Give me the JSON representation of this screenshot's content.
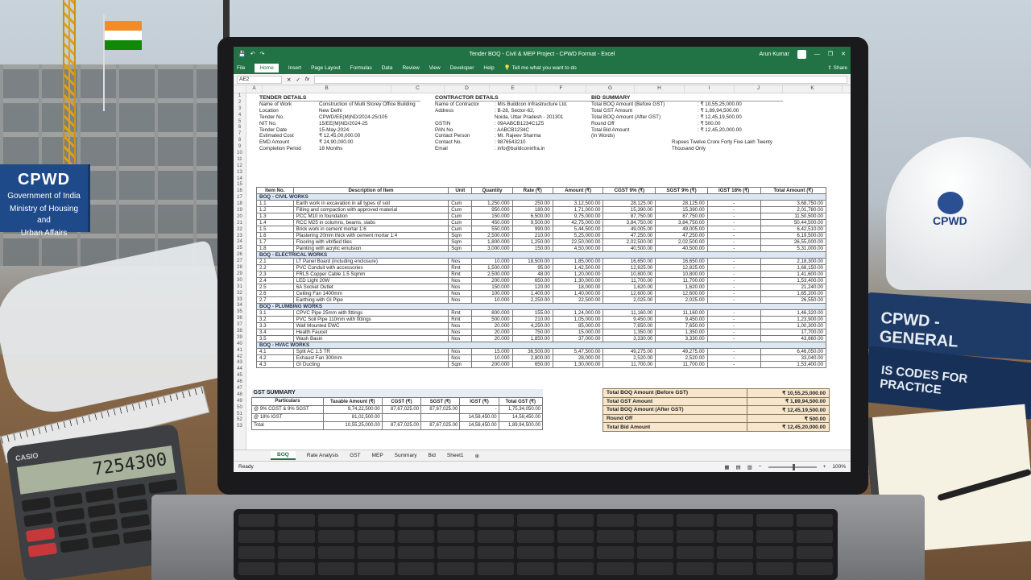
{
  "background": {
    "board": {
      "title": "CPWD",
      "line1": "Government of India",
      "line2": "Ministry of Housing and",
      "line3": "Urban Affairs"
    },
    "helmet_logo": "CPWD",
    "book1": "CPWD - GENERAL",
    "book2": "IS CODES FOR PRACTICE",
    "calculator": {
      "brand": "CASIO",
      "display": "7254300"
    }
  },
  "window": {
    "title": "Tender BOQ - Civil & MEP Project - CPWD Format - Excel",
    "user": "Arun Kumar",
    "tabs": [
      "File",
      "Home",
      "Insert",
      "Page Layout",
      "Formulas",
      "Data",
      "Review",
      "View",
      "Developer",
      "Help"
    ],
    "tell_me": "Tell me what you want to do",
    "share": "Share",
    "name_box": "AE2",
    "columns": [
      "A",
      "B",
      "C",
      "D",
      "E",
      "F",
      "G",
      "H",
      "I",
      "J",
      "K"
    ]
  },
  "tender": {
    "header": "TENDER DETAILS",
    "rows": [
      [
        "Name of Work",
        "Construction of Multi Storey Office Building"
      ],
      [
        "Location",
        "New Delhi"
      ],
      [
        "Tender No.",
        "CPWD/EE(M)ND/2024-25/105"
      ],
      [
        "NIT No.",
        "15/EE(M)ND/2024-25"
      ],
      [
        "Tender Date",
        "15-May-2024"
      ],
      [
        "Estimated Cost",
        "₹ 12,45,00,000.00"
      ],
      [
        "EMD Amount",
        "₹ 24,90,000.00"
      ],
      [
        "Completion Period",
        "18 Months"
      ]
    ]
  },
  "contractor": {
    "header": "CONTRACTOR DETAILS",
    "rows": [
      [
        "Name of Contractor",
        ": M/s Buildcon Infrastructure Ltd."
      ],
      [
        "Address",
        ": B-28, Sector-62,"
      ],
      [
        "",
        "Noida, Uttar Pradesh - 201301"
      ],
      [
        "GSTIN",
        ": 09AABCB1234C1Z5"
      ],
      [
        "PAN No.",
        ": AABCB1234C"
      ],
      [
        "Contact Person",
        ": Mr. Rajeev Sharma"
      ],
      [
        "Contact No.",
        ": 9876543210"
      ],
      [
        "Email",
        ": info@buildconinfra.in"
      ]
    ]
  },
  "bid": {
    "header": "BID SUMMARY",
    "rows": [
      [
        "Total BOQ Amount (Before GST)",
        ": ₹ 10,55,25,000.00"
      ],
      [
        "Total GST Amount",
        ": ₹ 1,89,94,500.00"
      ],
      [
        "Total BOQ Amount (After GST)",
        ": ₹ 12,45,19,500.00"
      ],
      [
        "Round Off",
        ": ₹ 500.00"
      ],
      [
        "Total Bid Amount",
        ": ₹ 12,45,20,000.00"
      ],
      [
        "(In Words)",
        "Rupees Twelve Crore Forty Five Lakh Twenty Thousand Only"
      ]
    ]
  },
  "boq": {
    "headers": [
      "Item No.",
      "Description of Item",
      "Unit",
      "Quantity",
      "Rate (₹)",
      "Amount (₹)",
      "CGST 9% (₹)",
      "SGST 9% (₹)",
      "IGST 18% (₹)",
      "Total Amount (₹)"
    ],
    "sections": [
      {
        "title": "BOQ - CIVIL WORKS",
        "rows": [
          [
            "1.1",
            "Earth work in excavation in all types of soil",
            "Cum",
            "1,250.000",
            "250.00",
            "3,12,500.00",
            "28,125.00",
            "28,125.00",
            "-",
            "3,68,750.00"
          ],
          [
            "1.2",
            "Filling and compaction with approved material",
            "Cum",
            "950.000",
            "180.00",
            "1,71,000.00",
            "15,390.00",
            "15,390.00",
            "-",
            "2,01,780.00"
          ],
          [
            "1.3",
            "PCC M10 in foundation",
            "Cum",
            "150.000",
            "6,500.00",
            "9,75,000.00",
            "87,750.00",
            "87,750.00",
            "-",
            "11,50,500.00"
          ],
          [
            "1.4",
            "RCC M25 in columns, beams, slabs",
            "Cum",
            "450.000",
            "9,500.00",
            "42,75,000.00",
            "3,84,750.00",
            "3,84,750.00",
            "-",
            "50,44,500.00"
          ],
          [
            "1.5",
            "Brick work in cement mortar 1:6",
            "Cum",
            "550.000",
            "990.00",
            "5,44,500.00",
            "49,005.00",
            "49,005.00",
            "-",
            "6,42,510.00"
          ],
          [
            "1.6",
            "Plastering 20mm thick with cement mortar 1:4",
            "Sqm",
            "2,500.000",
            "210.00",
            "5,25,000.00",
            "47,250.00",
            "47,250.00",
            "-",
            "6,19,500.00"
          ],
          [
            "1.7",
            "Flooring with vitrified tiles",
            "Sqm",
            "1,800.000",
            "1,250.00",
            "22,50,000.00",
            "2,02,500.00",
            "2,02,500.00",
            "-",
            "26,55,000.00"
          ],
          [
            "1.8",
            "Painting with acrylic emulsion",
            "Sqm",
            "3,000.000",
            "150.00",
            "4,50,000.00",
            "40,500.00",
            "40,500.00",
            "-",
            "5,31,000.00"
          ]
        ]
      },
      {
        "title": "BOQ - ELECTRICAL WORKS",
        "rows": [
          [
            "2.1",
            "LT Panel Board (including enclosure)",
            "Nos",
            "10.000",
            "18,500.00",
            "1,85,000.00",
            "16,650.00",
            "16,650.00",
            "-",
            "2,18,300.00"
          ],
          [
            "2.2",
            "PVC Conduit with accessories",
            "Rmt",
            "1,500.000",
            "95.00",
            "1,42,500.00",
            "12,825.00",
            "12,825.00",
            "-",
            "1,68,150.00"
          ],
          [
            "2.3",
            "FRLS Copper Cable 1.5 Sqmm",
            "Rmt",
            "2,500.000",
            "48.00",
            "1,20,000.00",
            "10,800.00",
            "10,800.00",
            "-",
            "1,41,600.00"
          ],
          [
            "2.4",
            "LED Light 20W",
            "Nos",
            "200.000",
            "650.00",
            "1,30,000.00",
            "11,700.00",
            "11,700.00",
            "-",
            "1,53,400.00"
          ],
          [
            "2.5",
            "6A Socket Outlet",
            "Nos",
            "150.000",
            "120.00",
            "18,000.00",
            "1,620.00",
            "1,620.00",
            "-",
            "21,240.00"
          ],
          [
            "2.6",
            "Ceiling Fan 1400mm",
            "Nos",
            "100.000",
            "1,400.00",
            "1,40,000.00",
            "12,600.00",
            "12,600.00",
            "-",
            "1,65,200.00"
          ],
          [
            "2.7",
            "Earthing with GI Pipe",
            "Nos",
            "10.000",
            "2,250.00",
            "22,500.00",
            "2,025.00",
            "2,025.00",
            "-",
            "26,550.00"
          ]
        ]
      },
      {
        "title": "BOQ - PLUMBING WORKS",
        "rows": [
          [
            "3.1",
            "CPVC Pipe 25mm with fittings",
            "Rmt",
            "800.000",
            "155.00",
            "1,24,000.00",
            "11,160.00",
            "11,160.00",
            "-",
            "1,46,320.00"
          ],
          [
            "3.2",
            "PVC Soil Pipe 110mm with fittings",
            "Rmt",
            "500.000",
            "210.00",
            "1,05,000.00",
            "9,450.00",
            "9,450.00",
            "-",
            "1,23,900.00"
          ],
          [
            "3.3",
            "Wall Mounted EWC",
            "Nos",
            "20.000",
            "4,250.00",
            "85,000.00",
            "7,650.00",
            "7,650.00",
            "-",
            "1,00,300.00"
          ],
          [
            "3.4",
            "Health Faucet",
            "Nos",
            "20.000",
            "750.00",
            "15,000.00",
            "1,350.00",
            "1,350.00",
            "-",
            "17,700.00"
          ],
          [
            "3.5",
            "Wash Basin",
            "Nos",
            "20.000",
            "1,850.00",
            "37,000.00",
            "3,330.00",
            "3,330.00",
            "-",
            "43,660.00"
          ]
        ]
      },
      {
        "title": "BOQ - HVAC WORKS",
        "rows": [
          [
            "4.1",
            "Split AC 1.5 TR",
            "Nos",
            "15.000",
            "36,500.00",
            "5,47,500.00",
            "49,275.00",
            "49,275.00",
            "-",
            "6,46,050.00"
          ],
          [
            "4.2",
            "Exhaust Fan 300mm",
            "Nos",
            "10.000",
            "2,800.00",
            "28,000.00",
            "2,520.00",
            "2,520.00",
            "-",
            "33,040.00"
          ],
          [
            "4.3",
            "GI Ducting",
            "Sqm",
            "200.000",
            "650.00",
            "1,30,000.00",
            "11,700.00",
            "11,700.00",
            "-",
            "1,53,400.00"
          ]
        ]
      }
    ]
  },
  "gst_summary": {
    "title": "GST SUMMARY",
    "headers": [
      "Particulars",
      "Taxable Amount (₹)",
      "CGST (₹)",
      "SGST (₹)",
      "IGST (₹)",
      "Total GST (₹)"
    ],
    "rows": [
      [
        "@ 9% CGST & 9% SGST",
        "9,74,22,500.00",
        "87,67,025.00",
        "87,67,025.00",
        "-",
        "1,75,34,050.00"
      ],
      [
        "@ 18% IGST",
        "81,02,500.00",
        "",
        "",
        "14,58,450.00",
        "14,58,450.00"
      ],
      [
        "Total",
        "10,55,25,000.00",
        "87,67,025.00",
        "87,67,025.00",
        "14,58,450.00",
        "1,89,94,500.00"
      ]
    ]
  },
  "totals_box": [
    [
      "Total BOQ Amount (Before GST)",
      "₹ 10,55,25,000.00"
    ],
    [
      "Total GST Amount",
      "₹ 1,89,94,500.00"
    ],
    [
      "Total BOQ Amount (After GST)",
      "₹ 12,45,19,500.00"
    ],
    [
      "Round Off",
      "₹ 500.00"
    ],
    [
      "Total Bid Amount",
      "₹ 12,45,20,000.00"
    ]
  ],
  "sheets": [
    "BOQ",
    "Rate Analysis",
    "GST",
    "MEP",
    "Summary",
    "Bid",
    "Sheet1"
  ],
  "status": {
    "ready": "Ready",
    "zoom": "100%"
  }
}
